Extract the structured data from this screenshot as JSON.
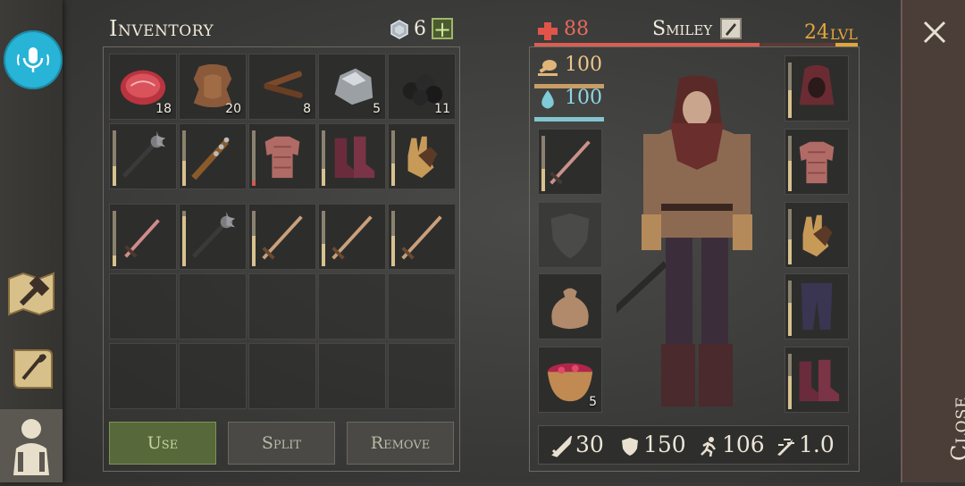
{
  "inventory": {
    "title": "Inventory",
    "gems_count": "6",
    "rows": [
      [
        {
          "item": "raw-meat",
          "count": "18"
        },
        {
          "item": "leather-hide",
          "count": "20"
        },
        {
          "item": "sticks",
          "count": "8"
        },
        {
          "item": "stone",
          "count": "5"
        },
        {
          "item": "coal",
          "count": "11"
        }
      ],
      [
        {
          "item": "iron-mace",
          "durability": 0.35
        },
        {
          "item": "spiked-club",
          "durability": 0.45
        },
        {
          "item": "padded-armor",
          "durability": 0.1
        },
        {
          "item": "leather-boots",
          "durability": 0.3
        },
        {
          "item": "leather-gloves",
          "durability": 0.4
        }
      ],
      [
        {
          "item": "dagger",
          "durability": 0.2
        },
        {
          "item": "iron-mace",
          "durability": 0.9
        },
        {
          "item": "wooden-sword",
          "durability": 0.55
        },
        {
          "item": "wooden-sword",
          "durability": 0.4
        },
        {
          "item": "wooden-sword",
          "durability": 0.55
        }
      ]
    ],
    "actions": {
      "use": "Use",
      "split": "Split",
      "remove": "Remove"
    }
  },
  "character": {
    "health": "88",
    "name": "Smiley",
    "level": "24",
    "level_label": "LVL",
    "food": "100",
    "water": "100",
    "health_fraction": 0.88,
    "xp_fraction": 0.2,
    "left_slots": [
      {
        "item": "sword",
        "durability": 0.4
      },
      {
        "item": "shield-empty"
      },
      {
        "item": "bag"
      },
      {
        "item": "berry-bowl",
        "count": "5"
      }
    ],
    "right_slots": [
      {
        "item": "hood",
        "durability": 0.5
      },
      {
        "item": "padded-armor",
        "durability": 0.55
      },
      {
        "item": "leather-gloves",
        "durability": 0.45
      },
      {
        "item": "pants",
        "durability": 0.6
      },
      {
        "item": "leather-boots",
        "durability": 0.6
      }
    ],
    "stats": {
      "attack": "30",
      "armor": "150",
      "speed": "106",
      "attack_speed": "1.0"
    }
  },
  "close_label": "Close",
  "colors": {
    "health": "#db5d51",
    "level": "#e2a43d",
    "food": "#c89d66",
    "water": "#83c5cf",
    "mic": "#27b4d6"
  }
}
